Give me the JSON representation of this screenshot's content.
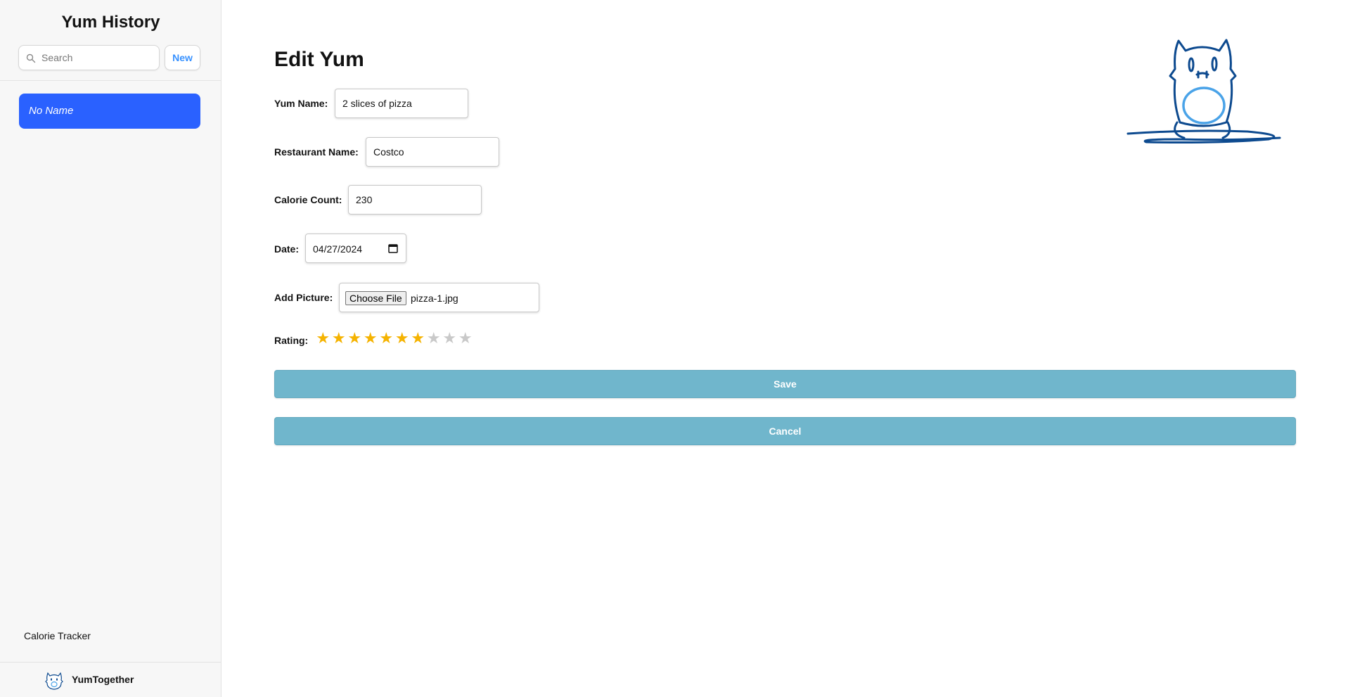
{
  "sidebar": {
    "title": "Yum History",
    "search": {
      "placeholder": "Search",
      "value": ""
    },
    "new_button": "New",
    "items": [
      {
        "label": "No Name",
        "active": true
      }
    ],
    "footer_link": "Calorie Tracker",
    "brand": "YumTogether"
  },
  "form": {
    "title": "Edit Yum",
    "yum_name": {
      "label": "Yum Name:",
      "value": "2 slices of pizza"
    },
    "restaurant_name": {
      "label": "Restaurant Name:",
      "value": "Costco"
    },
    "calorie_count": {
      "label": "Calorie Count:",
      "value": "230"
    },
    "date": {
      "label": "Date:",
      "value": "04/27/2024"
    },
    "picture": {
      "label": "Add Picture:",
      "button": "Choose File",
      "file_name": "pizza-1.jpg"
    },
    "rating": {
      "label": "Rating:",
      "value": 7,
      "max": 10
    },
    "save_button": "Save",
    "cancel_button": "Cancel"
  },
  "colors": {
    "accent": "#2a61ff",
    "new_link": "#3992ff",
    "action_button": "#70b6cc",
    "star_on": "#f5b301",
    "star_off": "#c9c9c9",
    "mascot_stroke": "#0d4a8f",
    "mascot_mouth": "#4aa3e8"
  },
  "icons": {
    "search": "search-icon",
    "calendar": "calendar-icon",
    "brand": "mascot-logo-icon",
    "star": "star-icon"
  }
}
